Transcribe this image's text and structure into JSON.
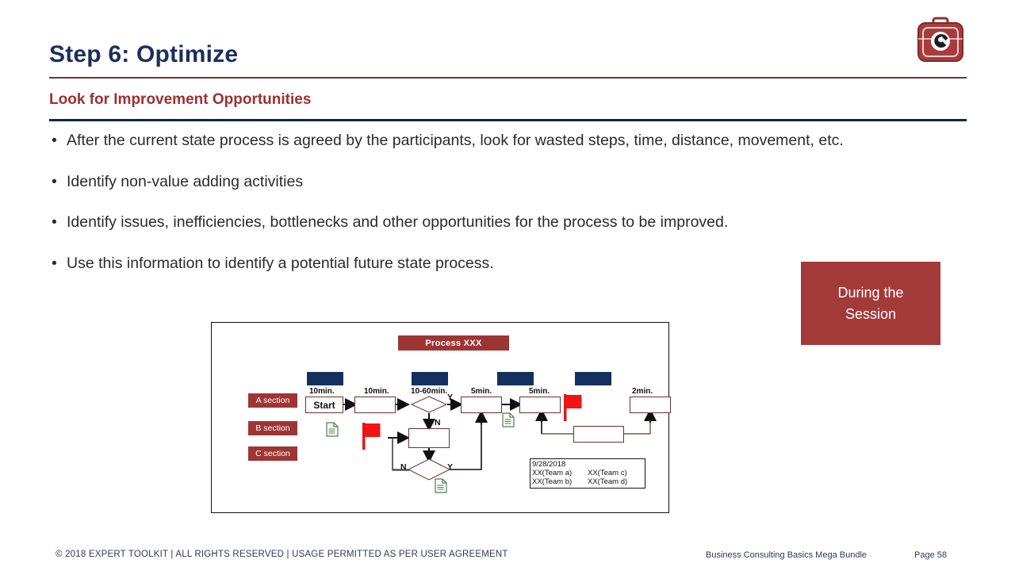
{
  "header": {
    "title": "Step 6: Optimize",
    "subtitle": "Look for Improvement Opportunities",
    "logo_icon": "toolkit-wrench-logo",
    "rule_top_color": "#7b3030",
    "rule_bottom_color": "#11283f",
    "title_color": "#1b2e5c",
    "subtitle_color": "#9e3030"
  },
  "bullets": [
    {
      "marker": "•",
      "text": "After the current state process is agreed by the participants, look for wasted steps, time, distance, movement, etc."
    },
    {
      "marker": "•",
      "text": "Identify non-value adding activities"
    },
    {
      "marker": "•",
      "text": "Identify issues, inefficiencies, bottlenecks and other opportunities for the process to be improved."
    },
    {
      "marker": "•",
      "text": "Use this information to identify a potential future state process."
    }
  ],
  "callout": {
    "line1": "During the",
    "line2": "Session",
    "bg_color": "#a33a3a",
    "text_color": "#ffffff"
  },
  "diagram": {
    "process_title": "Process XXX",
    "title_bg": "#9e3535",
    "section_labels": [
      {
        "name": "A section"
      },
      {
        "name": "B section"
      },
      {
        "name": "C section"
      }
    ],
    "durations": [
      {
        "label": "10min."
      },
      {
        "label": "10min."
      },
      {
        "label": "10-60min."
      },
      {
        "label": "5min."
      },
      {
        "label": "5min."
      },
      {
        "label": "2min."
      }
    ],
    "start_box_label": "Start",
    "decision_labels": [
      {
        "label": "Y"
      },
      {
        "label": "N"
      },
      {
        "label": "N"
      },
      {
        "label": "Y"
      }
    ],
    "legend": {
      "date": "9/28/2018",
      "teams": [
        {
          "left": "XX(Team a)",
          "right": "XX(Team c)"
        },
        {
          "left": "XX(Team b)",
          "right": "XX(Team d)"
        }
      ]
    },
    "flag_icon": "red-flag-icon",
    "document_icon": "green-document-icon",
    "navy_header_color": "#14305e",
    "box_border_color": "#6b3030"
  },
  "footer": {
    "copyright": "© 2018 EXPERT TOOLKIT | ALL RIGHTS RESERVED | USAGE PERMITTED AS PER USER AGREEMENT",
    "bundle": "Business Consulting Basics Mega Bundle",
    "page": "Page 58"
  }
}
